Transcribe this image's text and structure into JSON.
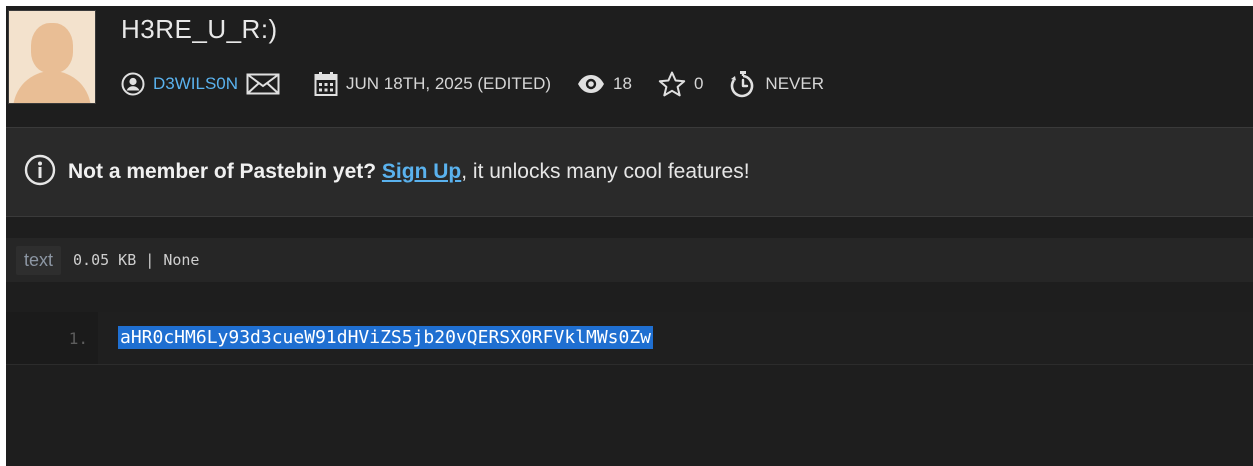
{
  "paste": {
    "title": "H3RE_U_R:)",
    "username": "D3WILS0N",
    "date": "JUN 18TH, 2025 (EDITED)",
    "views": "18",
    "stars": "0",
    "expiry": "NEVER"
  },
  "notice": {
    "lead": "Not a member of Pastebin yet?",
    "link": "Sign Up",
    "rest": ", it unlocks many cool features!"
  },
  "syntax": {
    "language": "text",
    "info": "0.05 KB | None"
  },
  "code": {
    "lines": [
      {
        "number": "1.",
        "text": "aHR0cHM6Ly93d3cueW91dHViZS5jb20vQERSX0RFVklMWs0Zw"
      }
    ]
  },
  "colors": {
    "background": "#1e1e1e",
    "accent": "#5ab2ee",
    "selection": "#1f6fd1"
  }
}
